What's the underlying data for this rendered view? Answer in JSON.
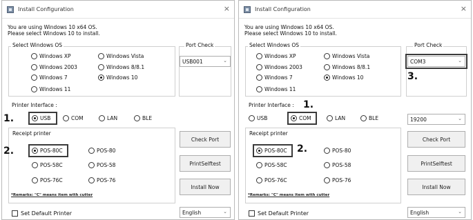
{
  "left": {
    "title": "Install Configuration",
    "info_line1": "You are using Windows 10 x64 OS.",
    "info_line2": "Please select Windows 10 to install.",
    "os_group_label": "Select Windows OS",
    "os_options": [
      "Windows XP",
      "Windows Vista",
      "Windows 2003",
      "Windows 8/8.1",
      "Windows 7",
      "Windows 10",
      "Windows 11"
    ],
    "port_check_label": "Port Check",
    "port_value": "USB001",
    "printer_interface_label": "Printer Interface :",
    "interfaces": [
      "USB",
      "COM",
      "LAN",
      "BLE"
    ],
    "receipt_label": "Receipt printer",
    "receipt_options": [
      "POS-80C",
      "POS-80",
      "POS-58C",
      "POS-58",
      "POS-76C",
      "POS-76"
    ],
    "remarks": "*Remarks: \"C\" means item with cutter",
    "check_port_label": "Check Port",
    "print_selftest_label": "PrintSelftest",
    "install_now_label": "Install Now",
    "set_default_label": "Set Default Printer",
    "language_value": "English",
    "step1": "1.",
    "step2": "2."
  },
  "right": {
    "title": "Install Configuration",
    "info_line1": "You are using Windows 10 x64 OS.",
    "info_line2": "Please select Windows 10 to install.",
    "os_group_label": "Select Windows OS",
    "os_options": [
      "Windows XP",
      "Windows Vista",
      "Windows 2003",
      "Windows 8/8.1",
      "Windows 7",
      "Windows 10",
      "Windows 11"
    ],
    "port_check_label": "Port Check",
    "port_value": "COM3",
    "printer_interface_label": "Printer Interface :",
    "interfaces": [
      "USB",
      "COM",
      "LAN",
      "BLE"
    ],
    "baud_value": "19200",
    "receipt_label": "Receipt printer",
    "receipt_options": [
      "POS-80C",
      "POS-80",
      "POS-58C",
      "POS-58",
      "POS-76C",
      "POS-76"
    ],
    "remarks": "*Remarks: \"C\" means item with cutter",
    "check_port_label": "Check Port",
    "print_selftest_label": "PrintSelftest",
    "install_now_label": "Install Now",
    "set_default_label": "Set Default Printer",
    "language_value": "English",
    "step1": "1.",
    "step2": "2.",
    "step3": "3."
  },
  "icons": {
    "close": "×",
    "chevron": "⌄"
  }
}
